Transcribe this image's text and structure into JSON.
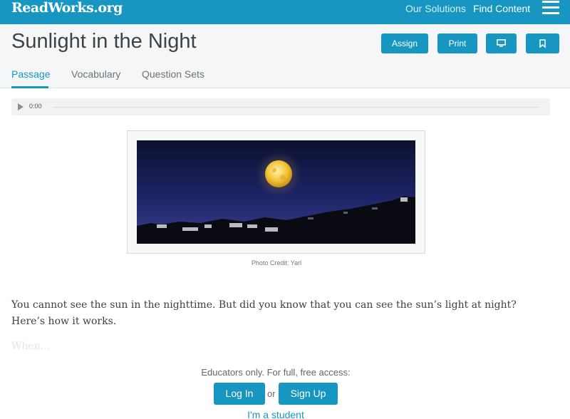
{
  "topbar": {
    "logo": "ReadWorks.org",
    "nav": {
      "solutions": "Our Solutions",
      "find_content": "Find Content"
    },
    "menu_icon": "hamburger-menu-icon",
    "color": "#1796c2"
  },
  "header": {
    "title": "Sunlight in the Night",
    "buttons": {
      "assign": "Assign",
      "print": "Print",
      "present_icon": "monitor-icon",
      "bookmark_icon": "bookmark-icon"
    }
  },
  "tabs": [
    {
      "label": "Passage",
      "active": true
    },
    {
      "label": "Vocabulary",
      "active": false
    },
    {
      "label": "Question Sets",
      "active": false
    }
  ],
  "audio": {
    "time": "0:00",
    "progress": 0
  },
  "photo": {
    "credit": "Photo Credit: Yarl"
  },
  "passage": {
    "paragraph": "You cannot see the sun in the nighttime. But did you know that you can see the sun’s light at night? Here’s how it works.",
    "faded_text": "When..."
  },
  "access": {
    "note": "Educators only. For full, free access:",
    "login": "Log In",
    "or": "or",
    "signup": "Sign Up",
    "student": "I'm a student"
  }
}
